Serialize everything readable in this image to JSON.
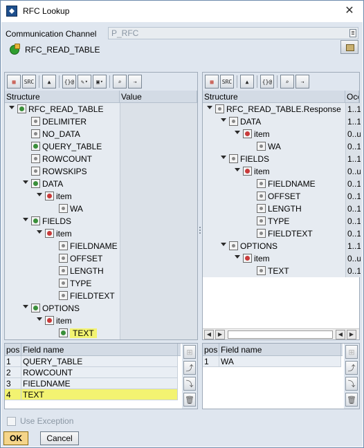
{
  "window": {
    "title": "RFC Lookup",
    "close_glyph": "✕"
  },
  "comm_channel": {
    "label": "Communication Channel",
    "value": "P_RFC"
  },
  "function_module": {
    "name": "RFC_READ_TABLE",
    "icon": "function-module-icon"
  },
  "left_tree": {
    "columns": [
      "Structure",
      "Value"
    ],
    "rows": [
      {
        "label": "RFC_READ_TABLE",
        "level": 0,
        "expanded": true,
        "icon": "green"
      },
      {
        "label": "DELIMITER",
        "level": 1,
        "icon": "leaf"
      },
      {
        "label": "NO_DATA",
        "level": 1,
        "icon": "leaf"
      },
      {
        "label": "QUERY_TABLE",
        "level": 1,
        "icon": "green"
      },
      {
        "label": "ROWCOUNT",
        "level": 1,
        "icon": "leaf"
      },
      {
        "label": "ROWSKIPS",
        "level": 1,
        "icon": "leaf"
      },
      {
        "label": "DATA",
        "level": 1,
        "expanded": true,
        "icon": "green"
      },
      {
        "label": "item",
        "level": 2,
        "expanded": true,
        "icon": "table"
      },
      {
        "label": "WA",
        "level": 3,
        "icon": "leaf"
      },
      {
        "label": "FIELDS",
        "level": 1,
        "expanded": true,
        "icon": "green"
      },
      {
        "label": "item",
        "level": 2,
        "expanded": true,
        "icon": "table"
      },
      {
        "label": "FIELDNAME",
        "level": 3,
        "icon": "leaf"
      },
      {
        "label": "OFFSET",
        "level": 3,
        "icon": "leaf"
      },
      {
        "label": "LENGTH",
        "level": 3,
        "icon": "leaf"
      },
      {
        "label": "TYPE",
        "level": 3,
        "icon": "leaf"
      },
      {
        "label": "FIELDTEXT",
        "level": 3,
        "icon": "leaf"
      },
      {
        "label": "OPTIONS",
        "level": 1,
        "expanded": true,
        "icon": "green"
      },
      {
        "label": "item",
        "level": 2,
        "expanded": true,
        "icon": "table"
      },
      {
        "label": "TEXT",
        "level": 3,
        "icon": "green",
        "highlight": true
      }
    ]
  },
  "right_tree": {
    "columns": [
      "Structure",
      "Occ"
    ],
    "rows": [
      {
        "label": "RFC_READ_TABLE.Response",
        "occ": "1..1",
        "level": 0,
        "expanded": true,
        "icon": "leaf"
      },
      {
        "label": "DATA",
        "occ": "1..1",
        "level": 1,
        "expanded": true,
        "icon": "leaf"
      },
      {
        "label": "item",
        "occ": "0..u",
        "level": 2,
        "expanded": true,
        "icon": "table"
      },
      {
        "label": "WA",
        "occ": "0..1",
        "level": 3,
        "icon": "leaf"
      },
      {
        "label": "FIELDS",
        "occ": "1..1",
        "level": 1,
        "expanded": true,
        "icon": "leaf"
      },
      {
        "label": "item",
        "occ": "0..u",
        "level": 2,
        "expanded": true,
        "icon": "table"
      },
      {
        "label": "FIELDNAME",
        "occ": "0..1",
        "level": 3,
        "icon": "leaf"
      },
      {
        "label": "OFFSET",
        "occ": "0..1",
        "level": 3,
        "icon": "leaf"
      },
      {
        "label": "LENGTH",
        "occ": "0..1",
        "level": 3,
        "icon": "leaf"
      },
      {
        "label": "TYPE",
        "occ": "0..1",
        "level": 3,
        "icon": "leaf"
      },
      {
        "label": "FIELDTEXT",
        "occ": "0..1",
        "level": 3,
        "icon": "leaf"
      },
      {
        "label": "OPTIONS",
        "occ": "1..1",
        "level": 1,
        "expanded": true,
        "icon": "leaf"
      },
      {
        "label": "item",
        "occ": "0..u",
        "level": 2,
        "expanded": true,
        "icon": "table"
      },
      {
        "label": "TEXT",
        "occ": "0..1",
        "level": 3,
        "icon": "leaf"
      }
    ]
  },
  "left_table": {
    "columns": [
      "pos",
      "Field name"
    ],
    "rows": [
      {
        "pos": "1",
        "field": "QUERY_TABLE"
      },
      {
        "pos": "2",
        "field": "ROWCOUNT"
      },
      {
        "pos": "3",
        "field": "FIELDNAME"
      },
      {
        "pos": "4",
        "field": "TEXT",
        "highlight": true
      }
    ]
  },
  "right_table": {
    "columns": [
      "pos",
      "Field name"
    ],
    "rows": [
      {
        "pos": "1",
        "field": "WA"
      }
    ]
  },
  "use_exception": {
    "label": "Use Exception",
    "checked": false
  },
  "buttons": {
    "ok": "OK",
    "cancel": "Cancel"
  },
  "toolbar_icons": {
    "left": [
      "grid-icon",
      "src-icon",
      "collapse-icon",
      "var-icon",
      "wand-icon",
      "select-icon",
      "find-icon",
      "find-next-icon"
    ],
    "right": [
      "grid-icon",
      "src-icon",
      "collapse-icon",
      "var-icon",
      "find-icon",
      "find-next-icon"
    ]
  }
}
